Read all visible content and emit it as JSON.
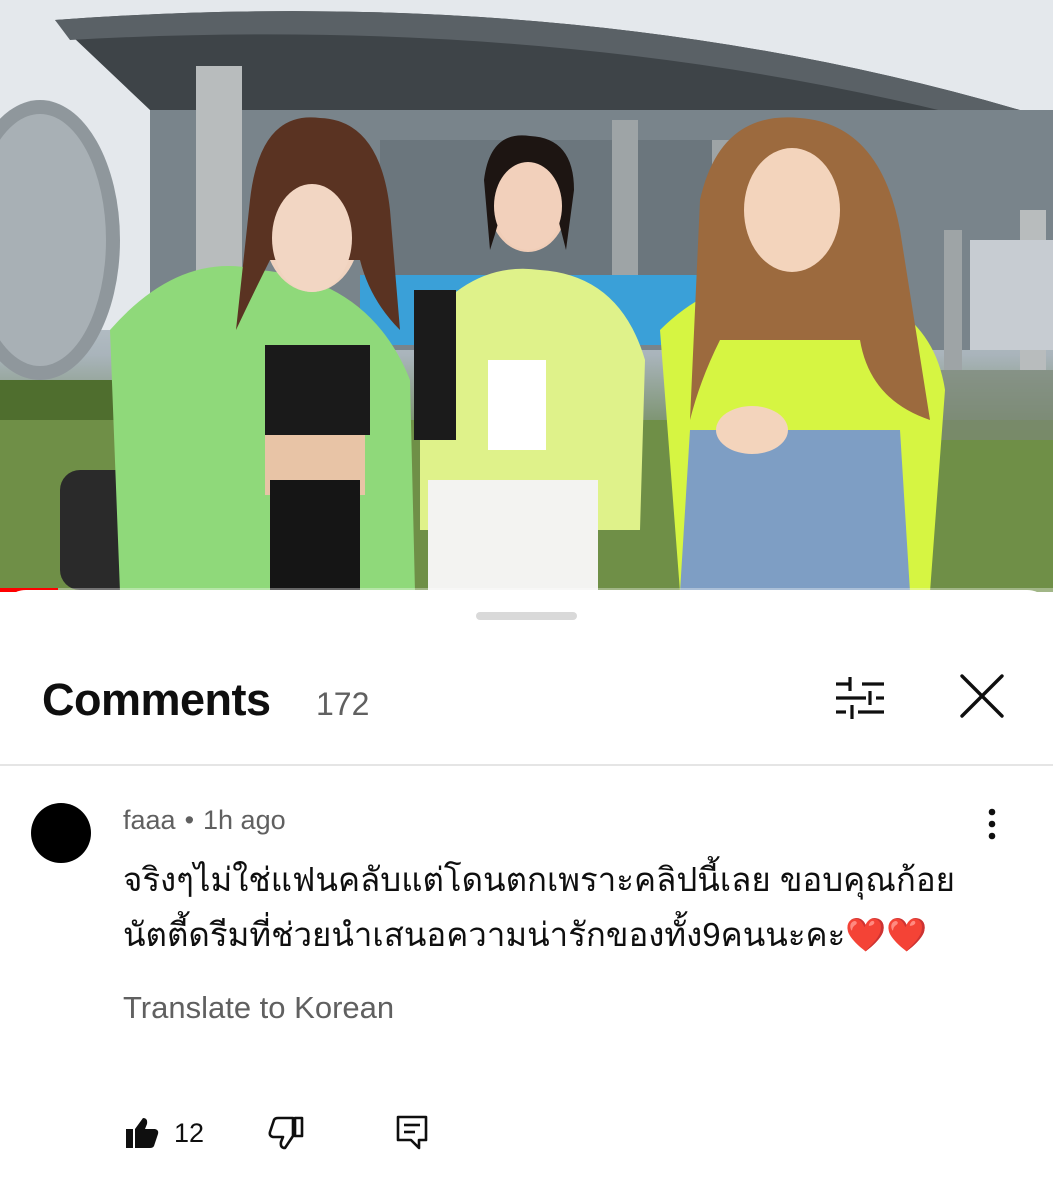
{
  "video": {
    "progress_fraction": 0.055
  },
  "comments_panel": {
    "title": "Comments",
    "count": "172",
    "filter_icon": "sliders-icon",
    "close_icon": "close-icon"
  },
  "comment": {
    "author": "faaa",
    "separator": "•",
    "time": "1h ago",
    "text_line1": "จริงๆไม่ใช่แฟนคลับแต่โดนตกเพราะคลิปนี้เลย ขอบคุณก้อย",
    "text_line2": "นัตตี้ดรีมที่ช่วยนำเสนอความน่ารักของทั้ง9คนนะคะ",
    "emoji": "❤️❤️",
    "translate_label": "Translate to Korean",
    "like_count": "12",
    "like_icon": "thumbs-up-icon",
    "dislike_icon": "thumbs-down-icon",
    "reply_icon": "reply-icon",
    "more_icon": "more-vert-icon"
  }
}
